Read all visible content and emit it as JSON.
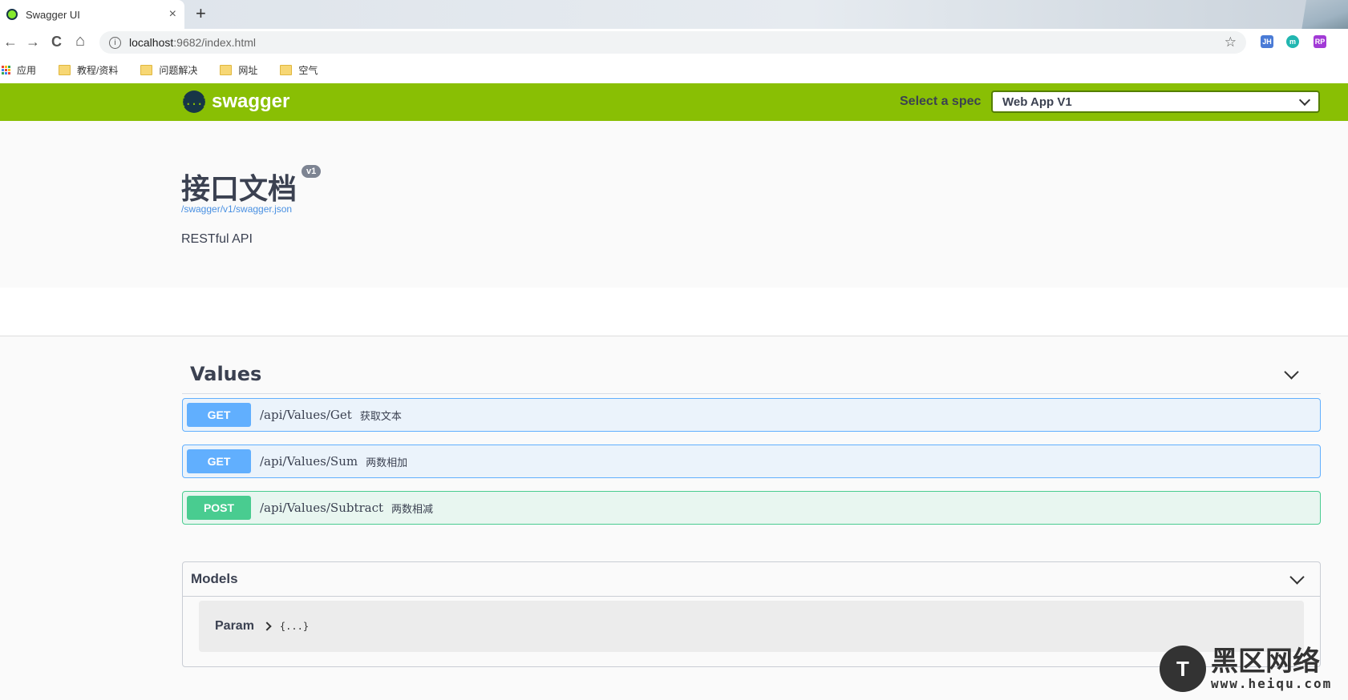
{
  "browser": {
    "tab_title": "Swagger UI",
    "tab_close": "×",
    "new_tab": "+",
    "url_host": "localhost",
    "url_path": ":9682/index.html",
    "nav": {
      "back": "←",
      "forward": "→",
      "reload": "C",
      "home": "⌂"
    },
    "star": "☆",
    "extensions": [
      {
        "label": "JH",
        "color": "#4a7bd6"
      },
      {
        "label": "m",
        "color": "#21b6b0"
      },
      {
        "label": "RP",
        "color": "#a23ad6"
      }
    ],
    "bookmarks": [
      {
        "label": "应用"
      },
      {
        "label": "教程/资料"
      },
      {
        "label": "问题解决"
      },
      {
        "label": "网址"
      },
      {
        "label": "空气"
      }
    ]
  },
  "topbar": {
    "logo_mark": "{...}",
    "logo_text": "swagger",
    "spec_label": "Select a spec",
    "spec_value": "Web App V1"
  },
  "info": {
    "title": "接口文档",
    "version": "v1",
    "spec_url": "/swagger/v1/swagger.json",
    "description": "RESTful API"
  },
  "tag": {
    "name": "Values"
  },
  "operations": [
    {
      "method": "GET",
      "path": "/api/Values/Get",
      "summary": "获取文本"
    },
    {
      "method": "GET",
      "path": "/api/Values/Sum",
      "summary": "两数相加"
    },
    {
      "method": "POST",
      "path": "/api/Values/Subtract",
      "summary": "两数相减"
    }
  ],
  "models": {
    "title": "Models",
    "items": [
      {
        "name": "Param",
        "preview": "{...}"
      }
    ]
  },
  "watermark": {
    "cn": "黑区网络",
    "url": "www.heiqu.com",
    "icon_letter": "T"
  },
  "colors": {
    "topbar": "#89bf04",
    "get": "#61affe",
    "post": "#49cc90"
  }
}
